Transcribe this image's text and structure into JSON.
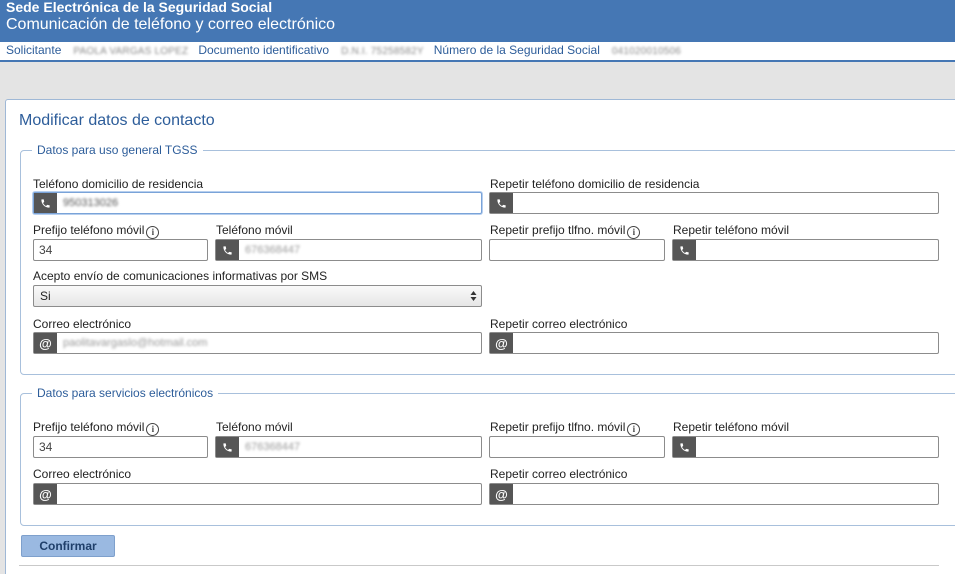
{
  "header": {
    "site": "Sede Electrónica de la Seguridad Social",
    "subtitle": "Comunicación de teléfono y correo electrónico"
  },
  "applicant": {
    "solicitante_label": "Solicitante",
    "solicitante_value": "PAOLA VARGAS LOPEZ",
    "documento_label": "Documento identificativo",
    "documento_value": "D.N.I. 75258582Y",
    "nss_label": "Número de la Seguridad Social",
    "nss_value": "041020010506"
  },
  "page_title": "Modificar datos de contacto",
  "general": {
    "legend": "Datos para uso general TGSS",
    "tel_home_label": "Teléfono domicilio de residencia",
    "tel_home_value": "950313026",
    "tel_home_repeat_label": "Repetir teléfono domicilio de residencia",
    "prefix_label": "Prefijo teléfono móvil",
    "prefix_value": "34",
    "mobile_label": "Teléfono móvil",
    "mobile_value": "676368447",
    "prefix_repeat_label": "Repetir prefijo tlfno. móvil",
    "mobile_repeat_label": "Repetir teléfono móvil",
    "sms_label": "Acepto envío de comunicaciones informativas por SMS",
    "sms_value": "Si",
    "email_label": "Correo electrónico",
    "email_value": "paolitavargaslo@hotmail.com",
    "email_repeat_label": "Repetir correo electrónico"
  },
  "electronic": {
    "legend": "Datos para servicios electrónicos",
    "prefix_label": "Prefijo teléfono móvil",
    "prefix_value": "34",
    "mobile_label": "Teléfono móvil",
    "mobile_value": "676368447",
    "prefix_repeat_label": "Repetir prefijo tlfno. móvil",
    "mobile_repeat_label": "Repetir teléfono móvil",
    "email_label": "Correo electrónico",
    "email_repeat_label": "Repetir correo electrónico"
  },
  "icons": {
    "info": "i",
    "email": "@"
  },
  "confirm_label": "Confirmar"
}
